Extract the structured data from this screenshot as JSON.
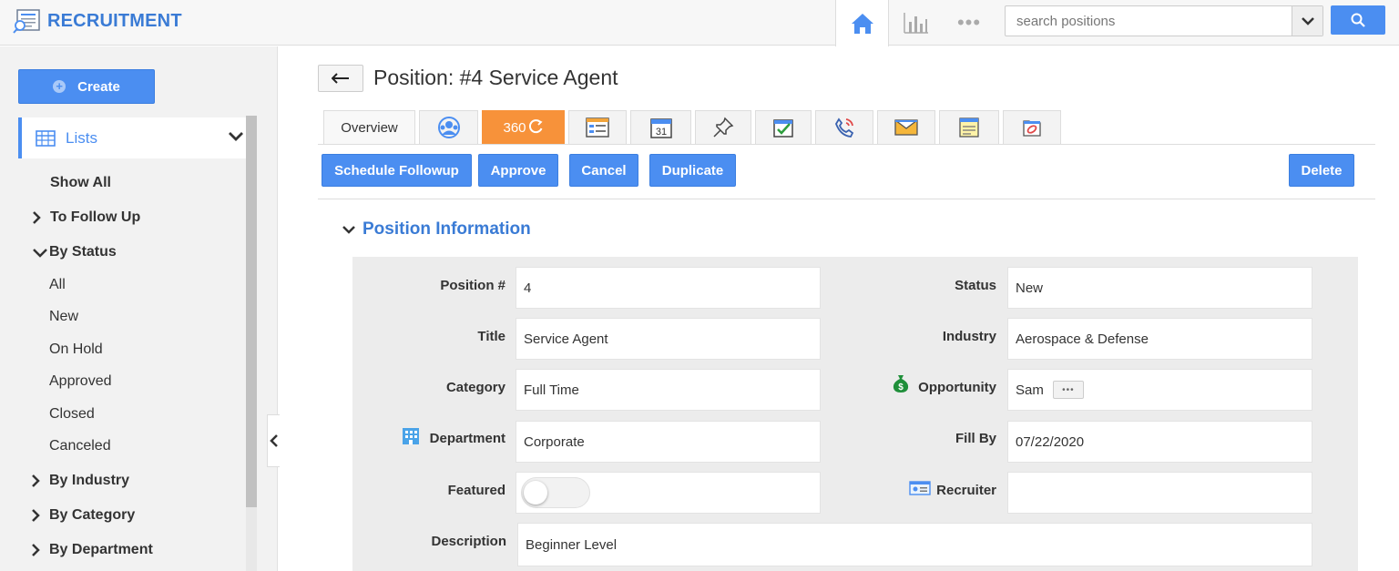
{
  "app": {
    "title": "RECRUITMENT"
  },
  "search": {
    "placeholder": "search positions"
  },
  "sidebar": {
    "create_label": "Create",
    "lists_label": "Lists",
    "items": [
      {
        "label": "Show All"
      },
      {
        "label": "To Follow Up"
      },
      {
        "label": "By Status"
      },
      {
        "label": "All"
      },
      {
        "label": "New"
      },
      {
        "label": "On Hold"
      },
      {
        "label": "Approved"
      },
      {
        "label": "Closed"
      },
      {
        "label": "Canceled"
      },
      {
        "label": "By Industry"
      },
      {
        "label": "By Category"
      },
      {
        "label": "By Department"
      }
    ]
  },
  "page": {
    "title": "Position: #4 Service Agent"
  },
  "tabs": {
    "overview": "Overview",
    "t360": "360"
  },
  "actions": {
    "schedule_followup": "Schedule Followup",
    "approve": "Approve",
    "cancel": "Cancel",
    "duplicate": "Duplicate",
    "delete": "Delete"
  },
  "section": {
    "title": "Position Information"
  },
  "fields": {
    "position_no": {
      "label": "Position #",
      "value": "4"
    },
    "status": {
      "label": "Status",
      "value": "New"
    },
    "title": {
      "label": "Title",
      "value": "Service Agent"
    },
    "industry": {
      "label": "Industry",
      "value": "Aerospace & Defense"
    },
    "category": {
      "label": "Category",
      "value": "Full Time"
    },
    "opportunity": {
      "label": "Opportunity",
      "value": "Sam"
    },
    "department": {
      "label": "Department",
      "value": "Corporate"
    },
    "fill_by": {
      "label": "Fill By",
      "value": "07/22/2020"
    },
    "featured": {
      "label": "Featured",
      "enabled": false
    },
    "recruiter": {
      "label": "Recruiter",
      "value": ""
    },
    "description": {
      "label": "Description",
      "value": "Beginner Level"
    }
  },
  "colors": {
    "accent": "#4b8ef1",
    "tab_active": "#f7923a",
    "title_blue": "#3a7bd5"
  }
}
